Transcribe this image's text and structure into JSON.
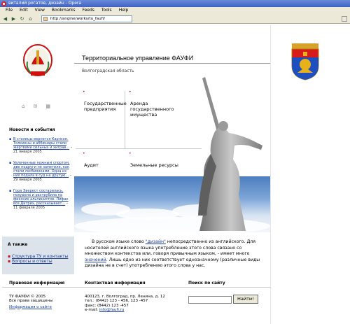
{
  "browser": {
    "title": "виталий рогатов, дизайн - Opera",
    "menu": [
      "File",
      "Edit",
      "View",
      "Bookmarks",
      "Feeds",
      "Tools",
      "Help"
    ],
    "address": "http://angine/works/tu_faufi/"
  },
  "header": {
    "title": "Территориальное управление ФАУФИ",
    "subtitle": "Волгоградская область"
  },
  "menu_items": [
    {
      "label": "Государственные предприятия"
    },
    {
      "label": "Аренда государственного имущества"
    },
    {
      "label": "Аудит"
    },
    {
      "label": "Земельные ресурсы"
    }
  ],
  "news": {
    "title": "Новости и события",
    "items": [
      {
        "link": "В столицы вернется Карлсон. Толкиены и аббюнары стали жертвами сильных и хитрав...",
        "date": "– 21 января 2005"
      },
      {
        "link": "Увлеченные ножным спортом, две подруги не заметили, как стали лесбиянками. Одна из них подала в суд на другую...",
        "date": "– 29 января 2005"
      },
      {
        "link": "Гора Эверест состарилась, похудела и раструбила на фикских альпинистов. Лифак все Дитрих, рассказывает...",
        "date": "– 11 февраля 2005"
      }
    ]
  },
  "also": {
    "title": "А также",
    "links": [
      "Структура ТУ и контакты",
      "Вопросы и ответы"
    ]
  },
  "intro": {
    "part1": "В русском языке слово ",
    "link1": "\"дизайн\"",
    "part2": " непосредственно из английского. Для носителей английского языка употребление этого слова связано со множеством контекстов или, говоря привычным языком, - имеет много ",
    "link2": "значений",
    "part3": ". Лишь одно из них соответствует однозначному (различные виды дизайна не в счет) употреблению этого слова у нас."
  },
  "footer": {
    "legal_title": "Правовая информация",
    "legal_line1": "ТУ ФАУФИ © 2005",
    "legal_line2": "Все права защищены",
    "legal_link": "Информация о сайте",
    "contact_title": "Контактная информация",
    "contact_address": "400123, г. Волгоград, пр. Ленина, д. 12",
    "contact_tel": "тел.: (8442) 123 - 456, 123 -457",
    "contact_fax": "факс: (8442) 123 -457",
    "contact_email_label": "e-mail: ",
    "contact_email": "info@faufi.ru",
    "search_title": "Поиск по сайту",
    "search_button": "Найти!"
  },
  "colors": {
    "link": "#1a3f9c",
    "accent": "#cc1111",
    "also_bg": "#dde3ea"
  }
}
